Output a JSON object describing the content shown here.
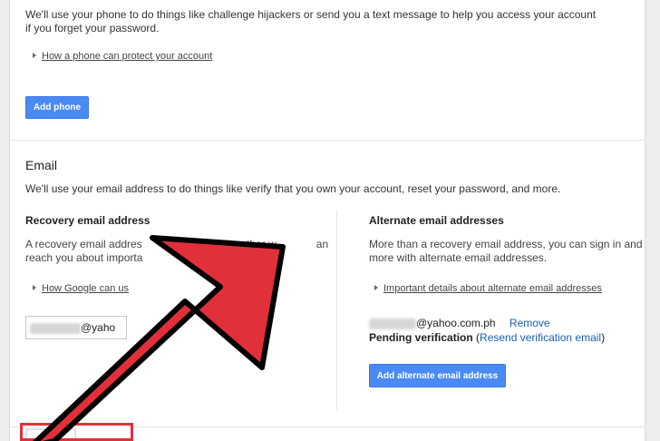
{
  "phone": {
    "intro_line1": "We'll use your phone to do things like challenge hijackers or send you a text message to help you access your account",
    "intro_line2": "if you forget your password.",
    "expander_label": "How a phone can protect your account",
    "add_phone_label": "Add phone"
  },
  "email": {
    "section_title": "Email",
    "description": "We'll use your email address to do things like verify that you own your account, reset your password, and more.",
    "recovery": {
      "title": "Recovery email address",
      "desc_line1": "A recovery email address provides another way to reach you about important changes to your account.",
      "desc_visible_line1a": "A recovery email addres",
      "desc_visible_line1b": "vides another w",
      "desc_visible_line1c": "an",
      "desc_visible_line2a": "reach you about importa",
      "desc_visible_line2b": "nges to yo",
      "expander_label_visible": "How Google can us",
      "input_suffix": "@yaho"
    },
    "alternate": {
      "title": "Alternate email addresses",
      "desc_line1": "More than a recovery email address, you can sign in and",
      "desc_line2": "more with alternate email addresses.",
      "expander_label": "Important details about alternate email addresses",
      "address_suffix": "@yahoo.com.ph",
      "remove_label": "Remove",
      "pending_label": "Pending verification",
      "resend_label": "Resend verification email",
      "add_button_label": "Add alternate email address"
    }
  },
  "colors": {
    "accent_blue": "#4a8af4",
    "link_blue": "#1a5fb4",
    "arrow_red": "#e1303a"
  }
}
